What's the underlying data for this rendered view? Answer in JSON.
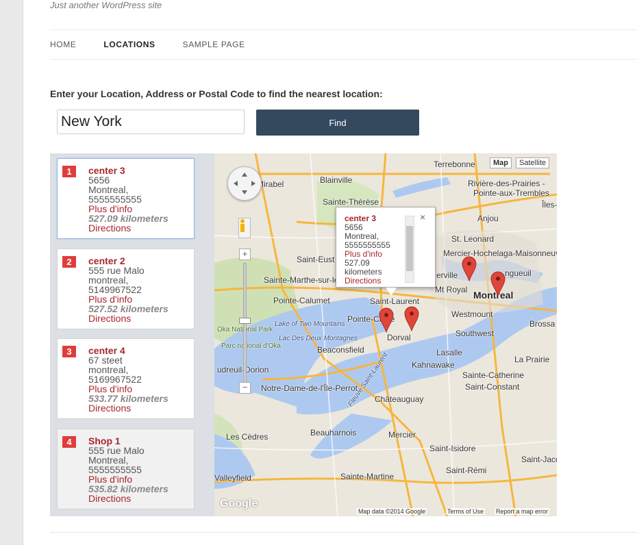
{
  "site": {
    "tagline": "Just another WordPress site"
  },
  "nav": {
    "items": [
      "HOME",
      "LOCATIONS",
      "SAMPLE PAGE"
    ],
    "active": "LOCATIONS"
  },
  "search": {
    "prompt": "Enter your Location, Address or Postal Code to find the nearest location:",
    "value": "New York",
    "button_label": "Find"
  },
  "results": [
    {
      "num": "1",
      "name": "center 3",
      "address": "5656",
      "city": "Montreal,",
      "phone": "5555555555",
      "info_link": "Plus d'info",
      "distance": "527.09 kilometers",
      "directions": "Directions"
    },
    {
      "num": "2",
      "name": "center 2",
      "address": "555 rue Malo",
      "city": "montreal,",
      "phone": "5149967522",
      "info_link": "Plus d'info",
      "distance": "527.52 kilometers",
      "directions": "Directions"
    },
    {
      "num": "3",
      "name": "center 4",
      "address": "67 steet",
      "city": "montreal,",
      "phone": "5169967522",
      "info_link": "Plus d'info",
      "distance": "533.77 kilometers",
      "directions": "Directions"
    },
    {
      "num": "4",
      "name": "Shop 1",
      "address": "555 rue Malo",
      "city": "Montreal,",
      "phone": "5555555555",
      "info_link": "Plus d'info",
      "distance": "535.82 kilometers",
      "directions": "Directions"
    }
  ],
  "map": {
    "type_buttons": [
      "Map",
      "Satellite"
    ],
    "info_window": {
      "name": "center 3",
      "address": "5656",
      "city": "Montreal,",
      "phone": "5555555555",
      "info_link": "Plus d'info",
      "distance_value": "527.09",
      "distance_unit": "kilometers",
      "directions": "Directions",
      "close": "×"
    },
    "labels": {
      "terrebonne": "Terrebonne",
      "mirabel": "Mirabel",
      "blainville": "Blainville",
      "riviere": "Rivière-des-Prairies -",
      "pointe_trembles": "Pointe-aux-Trembles",
      "iles": "Îles-",
      "sainte_therese": "Sainte-Thérèse",
      "anjou": "Anjou",
      "st_leonard": "St. Leonard",
      "saint_eustache": "Saint-Eust",
      "mercier": "Mercier-Hochelaga-Maisonneuve",
      "sainte_marthe": "Sainte-Marthe-sur-le-Lac",
      "erville": "erville",
      "ngueuil": "ngueuil",
      "mt_royal": "Mt Royal",
      "montreal": "Montreal",
      "pointe_calumet": "Pointe-Calumet",
      "saint_laurent": "Saint-Laurent",
      "pointe_claire": "Pointe-Claire",
      "westmount": "Westmount",
      "brossa": "Brossa",
      "lake_two_mountains": "Lake of Two Mountains",
      "lac_deux": "Lac Des Deux Montagnes",
      "oka_park": "Oka National Park",
      "parc_oka": "Parc national d'Oka",
      "dorval": "Dorval",
      "southwest": "Southwest",
      "beaconsfield": "Beaconsfield",
      "lasalle": "Lasalle",
      "kahnawake": "Kahnawake",
      "la_prairie": "La Prairie",
      "vaudreuil": "udreuil-Dorion",
      "sainte_catherine": "Sainte-Catherine",
      "notre_dame": "Notre-Dame-de-l'Île-Perrot",
      "saint_constant": "Saint-Constant",
      "fleuve": "Fleuve Saint-Laurent",
      "chateauguay": "Châteauguay",
      "les_cedres": "Les Cèdres",
      "beauharnois": "Beauharnois",
      "mercier_town": "Mercier",
      "saint_jacq": "Saint-Jacq",
      "saint_isidore": "Saint-Isidore",
      "saint_remi": "Saint-Rémi",
      "valleyfield": "Valleyfield",
      "sainte_martine": "Sainte-Martine"
    },
    "footer": {
      "data": "Map data ©2014 Google",
      "terms": "Terms of Use",
      "report": "Report a map error"
    },
    "logo": "Google",
    "markers": [
      "center 3",
      "center 2",
      "center 4",
      "Shop 1"
    ]
  }
}
